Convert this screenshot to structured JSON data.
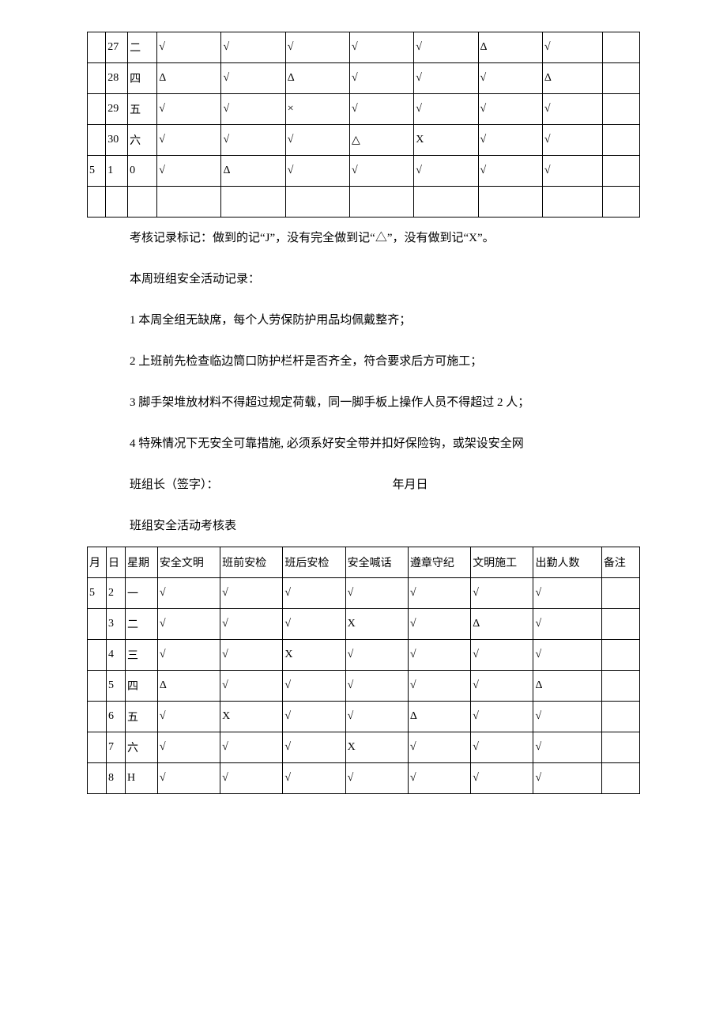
{
  "symbols": {
    "check": "√",
    "triangle": "△",
    "x": "X",
    "cross": "×",
    "zero": "0",
    "tri_bold": "Δ"
  },
  "table1_rows": [
    {
      "m": "",
      "d": "27",
      "w": "二",
      "c": [
        "√",
        "√",
        "√",
        "√",
        "√",
        "Δ",
        "√",
        ""
      ]
    },
    {
      "m": "",
      "d": "28",
      "w": "四",
      "c": [
        "Δ",
        "√",
        "Δ",
        "√",
        "√",
        "√",
        "Δ",
        ""
      ]
    },
    {
      "m": "",
      "d": "29",
      "w": "五",
      "c": [
        "√",
        "√",
        "×",
        "√",
        "√",
        "√",
        "√",
        ""
      ]
    },
    {
      "m": "",
      "d": "30",
      "w": "六",
      "c": [
        "√",
        "√",
        "√",
        "△",
        "X",
        "√",
        "√",
        ""
      ]
    },
    {
      "m": "5",
      "d": "1",
      "w": "0",
      "c": [
        "√",
        "Δ",
        "√",
        "√",
        "√",
        "√",
        "√",
        ""
      ]
    },
    {
      "m": "",
      "d": "",
      "w": "",
      "c": [
        "",
        "",
        "",
        "",
        "",
        "",
        "",
        ""
      ]
    }
  ],
  "text": {
    "legend": "考核记录标记：做到的记“J”，没有完全做到记“△”，没有做到记“X”。",
    "t1": "本周班组安全活动记录：",
    "p1": "1 本周全组无缺席，每个人劳保防护用品均佩戴整齐；",
    "p2": "2 上班前先检查临边筒口防护栏杆是否齐全，符合要求后方可施工；",
    "p3": "3 脚手架堆放材料不得超过规定荷载，同一脚手板上操作人员不得超过 2 人；",
    "p4": "4 特殊情况下无安全可靠措施, 必须系好安全带并扣好保险钩，或架设安全网",
    "sig": "班组长（签字）：",
    "date": "年月日",
    "title2": "班组安全活动考核表"
  },
  "table2_header": [
    "月",
    "日",
    "星期",
    "安全文明",
    "班前安检",
    "班后安检",
    "安全喊话",
    "遵章守纪",
    "文明施工",
    "出勤人数",
    "备注"
  ],
  "table2_rows": [
    {
      "m": "5",
      "d": "2",
      "w": "一",
      "c": [
        "√",
        "√",
        "√",
        "√",
        "√",
        "√",
        "√",
        ""
      ]
    },
    {
      "m": "",
      "d": "3",
      "w": "二",
      "c": [
        "√",
        "√",
        "√",
        "X",
        "√",
        "Δ",
        "√",
        ""
      ]
    },
    {
      "m": "",
      "d": "4",
      "w": "三",
      "c": [
        "√",
        "√",
        "X",
        "√",
        "√",
        "√",
        "√",
        ""
      ]
    },
    {
      "m": "",
      "d": "5",
      "w": "四",
      "c": [
        "Δ",
        "√",
        "√",
        "√",
        "√",
        "√",
        "Δ",
        ""
      ]
    },
    {
      "m": "",
      "d": "6",
      "w": "五",
      "c": [
        "√",
        "X",
        "√",
        "√",
        "Δ",
        "√",
        "√",
        ""
      ]
    },
    {
      "m": "",
      "d": "7",
      "w": "六",
      "c": [
        "√",
        "√",
        "√",
        "X",
        "√",
        "√",
        "√",
        ""
      ]
    },
    {
      "m": "",
      "d": "8",
      "w": "H",
      "c": [
        "√",
        "√",
        "√",
        "√",
        "√",
        "√",
        "√",
        ""
      ]
    }
  ]
}
